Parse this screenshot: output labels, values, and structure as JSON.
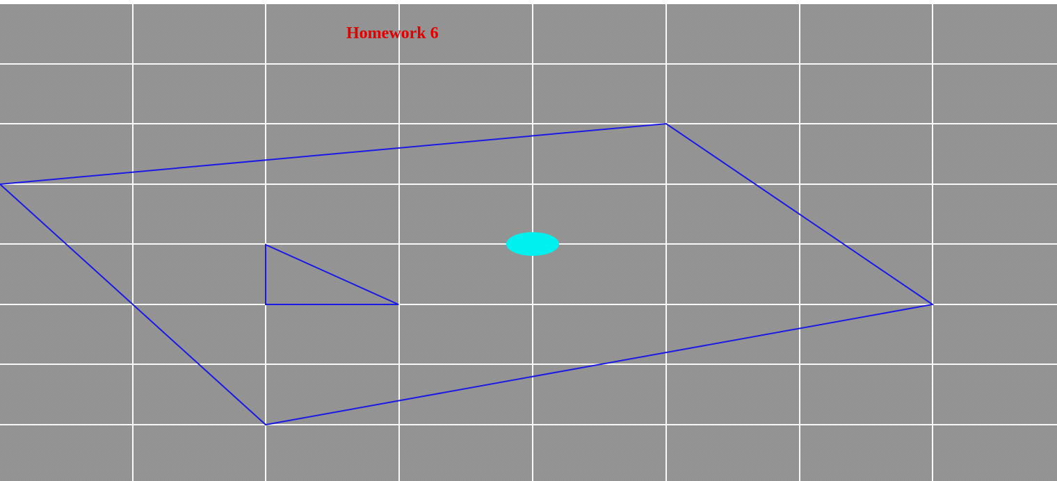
{
  "title": "Homework 6",
  "colors": {
    "background": "#8c8c8c",
    "grid": "#ffffff",
    "title": "#e00000",
    "shape_stroke": "#1a1ae6",
    "ellipse_fill": "#00f0f0"
  }
}
